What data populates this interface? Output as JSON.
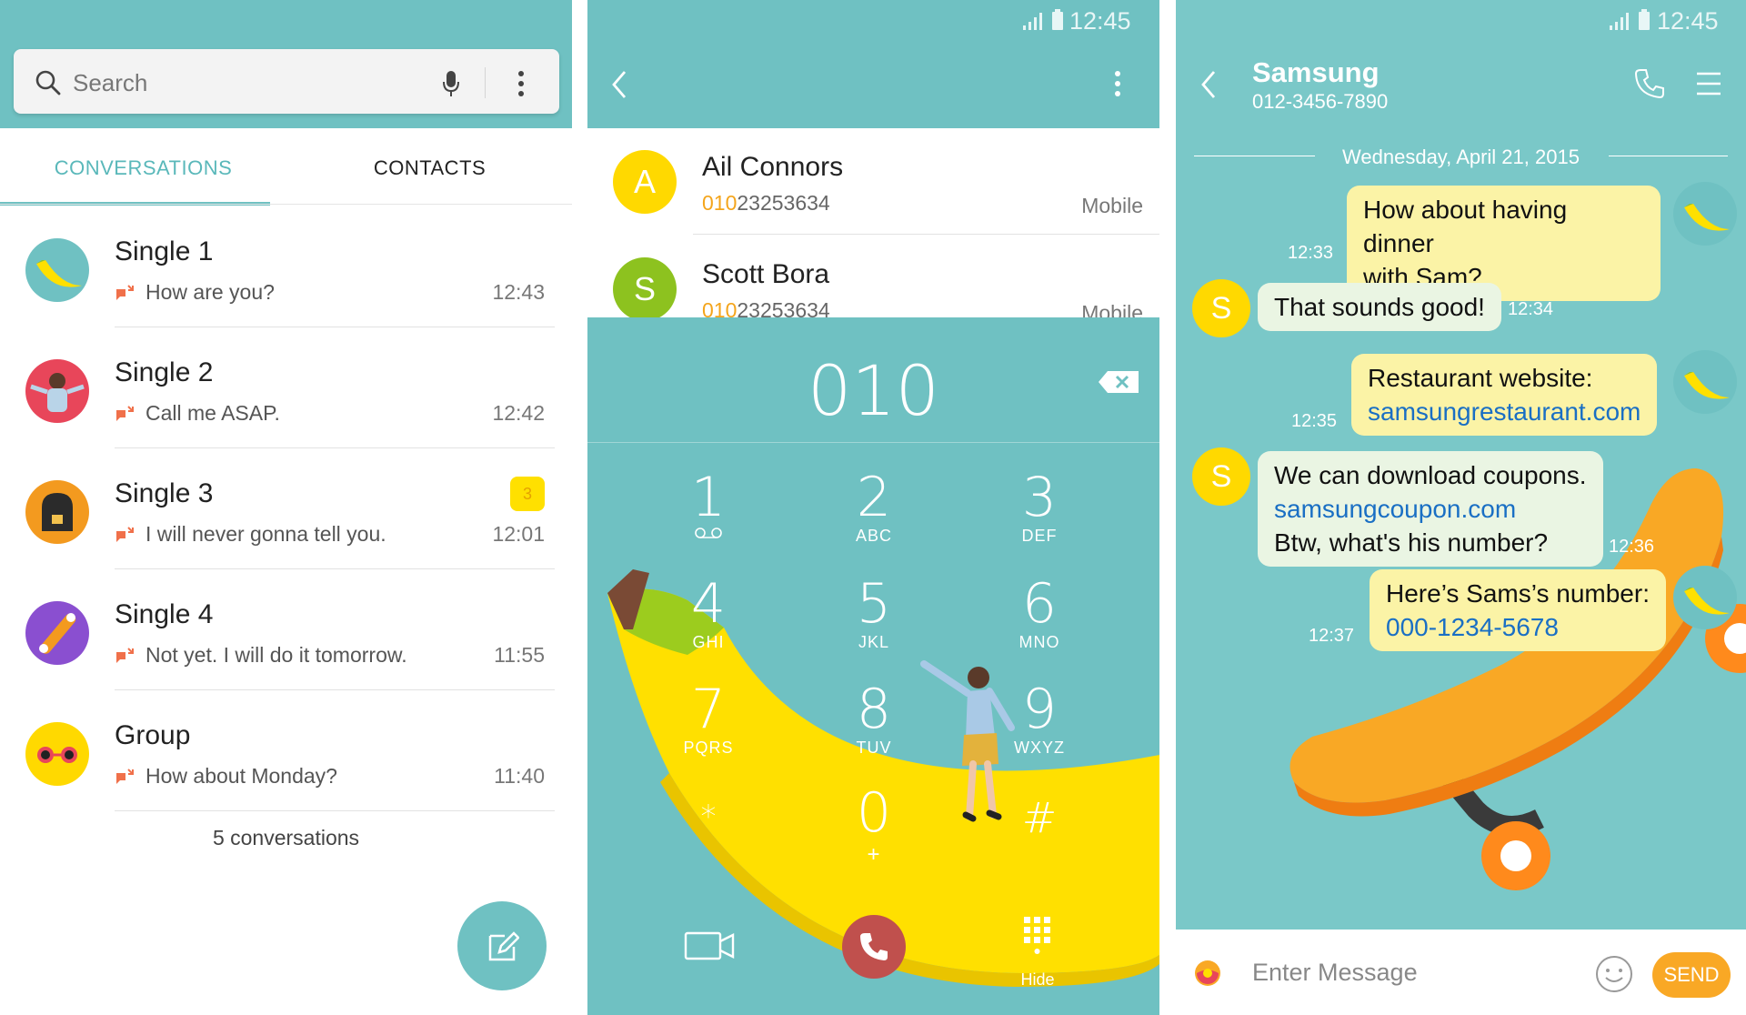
{
  "colors": {
    "teal": "#6fc1c2",
    "teal_light": "#7ac8c8",
    "banana_yellow": "#ffe000",
    "call_red": "#c0504d",
    "send_orange": "#f9a825",
    "link_blue": "#1a6fc4"
  },
  "messages_list": {
    "search": {
      "placeholder": "Search"
    },
    "tabs": [
      {
        "label": "CONVERSATIONS",
        "active": true
      },
      {
        "label": "CONTACTS",
        "active": false
      }
    ],
    "conversations": [
      {
        "name": "Single 1",
        "preview": "How are you?",
        "time": "12:43",
        "avatar_icon": "banana-avatar-icon"
      },
      {
        "name": "Single 2",
        "preview": "Call me ASAP.",
        "time": "12:42",
        "avatar_icon": "girl-avatar-icon"
      },
      {
        "name": "Single 3",
        "preview": "I will never gonna tell you.",
        "time": "12:01",
        "badge": "3",
        "avatar_icon": "backpack-avatar-icon"
      },
      {
        "name": "Single 4",
        "preview": "Not yet. I will do it tomorrow.",
        "time": "11:55",
        "avatar_icon": "skateboard-avatar-icon"
      },
      {
        "name": "Group",
        "preview": "How about Monday?",
        "time": "11:40",
        "avatar_icon": "sunglasses-avatar-icon"
      }
    ],
    "footer_count": "5 conversations"
  },
  "dialer": {
    "status_time": "12:45",
    "contacts": [
      {
        "initial": "A",
        "name": "Ail Connors",
        "number_match": "010",
        "number_rest": "23253634",
        "type": "Mobile"
      },
      {
        "initial": "S",
        "name": "Scott Bora",
        "number_match": "010",
        "number_rest": "23253634",
        "type": "Mobile"
      }
    ],
    "entered_number": "010",
    "keys": [
      {
        "digit": "1",
        "letters": ""
      },
      {
        "digit": "2",
        "letters": "ABC"
      },
      {
        "digit": "3",
        "letters": "DEF"
      },
      {
        "digit": "4",
        "letters": "GHI"
      },
      {
        "digit": "5",
        "letters": "JKL"
      },
      {
        "digit": "6",
        "letters": "MNO"
      },
      {
        "digit": "7",
        "letters": "PQRS"
      },
      {
        "digit": "8",
        "letters": "TUV"
      },
      {
        "digit": "9",
        "letters": "WXYZ"
      },
      {
        "digit": "*",
        "letters": ""
      },
      {
        "digit": "0",
        "letters": "+"
      },
      {
        "digit": "#",
        "letters": ""
      }
    ],
    "hide_label": "Hide"
  },
  "chat": {
    "status_time": "12:45",
    "contact_name": "Samsung",
    "contact_number": "012-3456-7890",
    "date_label": "Wednesday, April 21, 2015",
    "messages": [
      {
        "dir": "out",
        "lines": [
          "How about having dinner",
          "with Sam?"
        ],
        "time": "12:33"
      },
      {
        "dir": "in",
        "lines": [
          "That sounds good!"
        ],
        "time": "12:34"
      },
      {
        "dir": "out",
        "lines": [
          "Restaurant website:"
        ],
        "link": "samsungrestaurant.com",
        "time": "12:35"
      },
      {
        "dir": "in",
        "lines": [
          "We can download coupons."
        ],
        "link": "samsungcoupon.com",
        "after": "Btw, what's his number?",
        "time": "12:36"
      },
      {
        "dir": "out",
        "lines": [
          "Here’s Sams’s number:"
        ],
        "link": "000-1234-5678",
        "time": "12:37"
      }
    ],
    "incoming_initial": "S",
    "input_placeholder": "Enter Message",
    "send_label": "SEND"
  }
}
